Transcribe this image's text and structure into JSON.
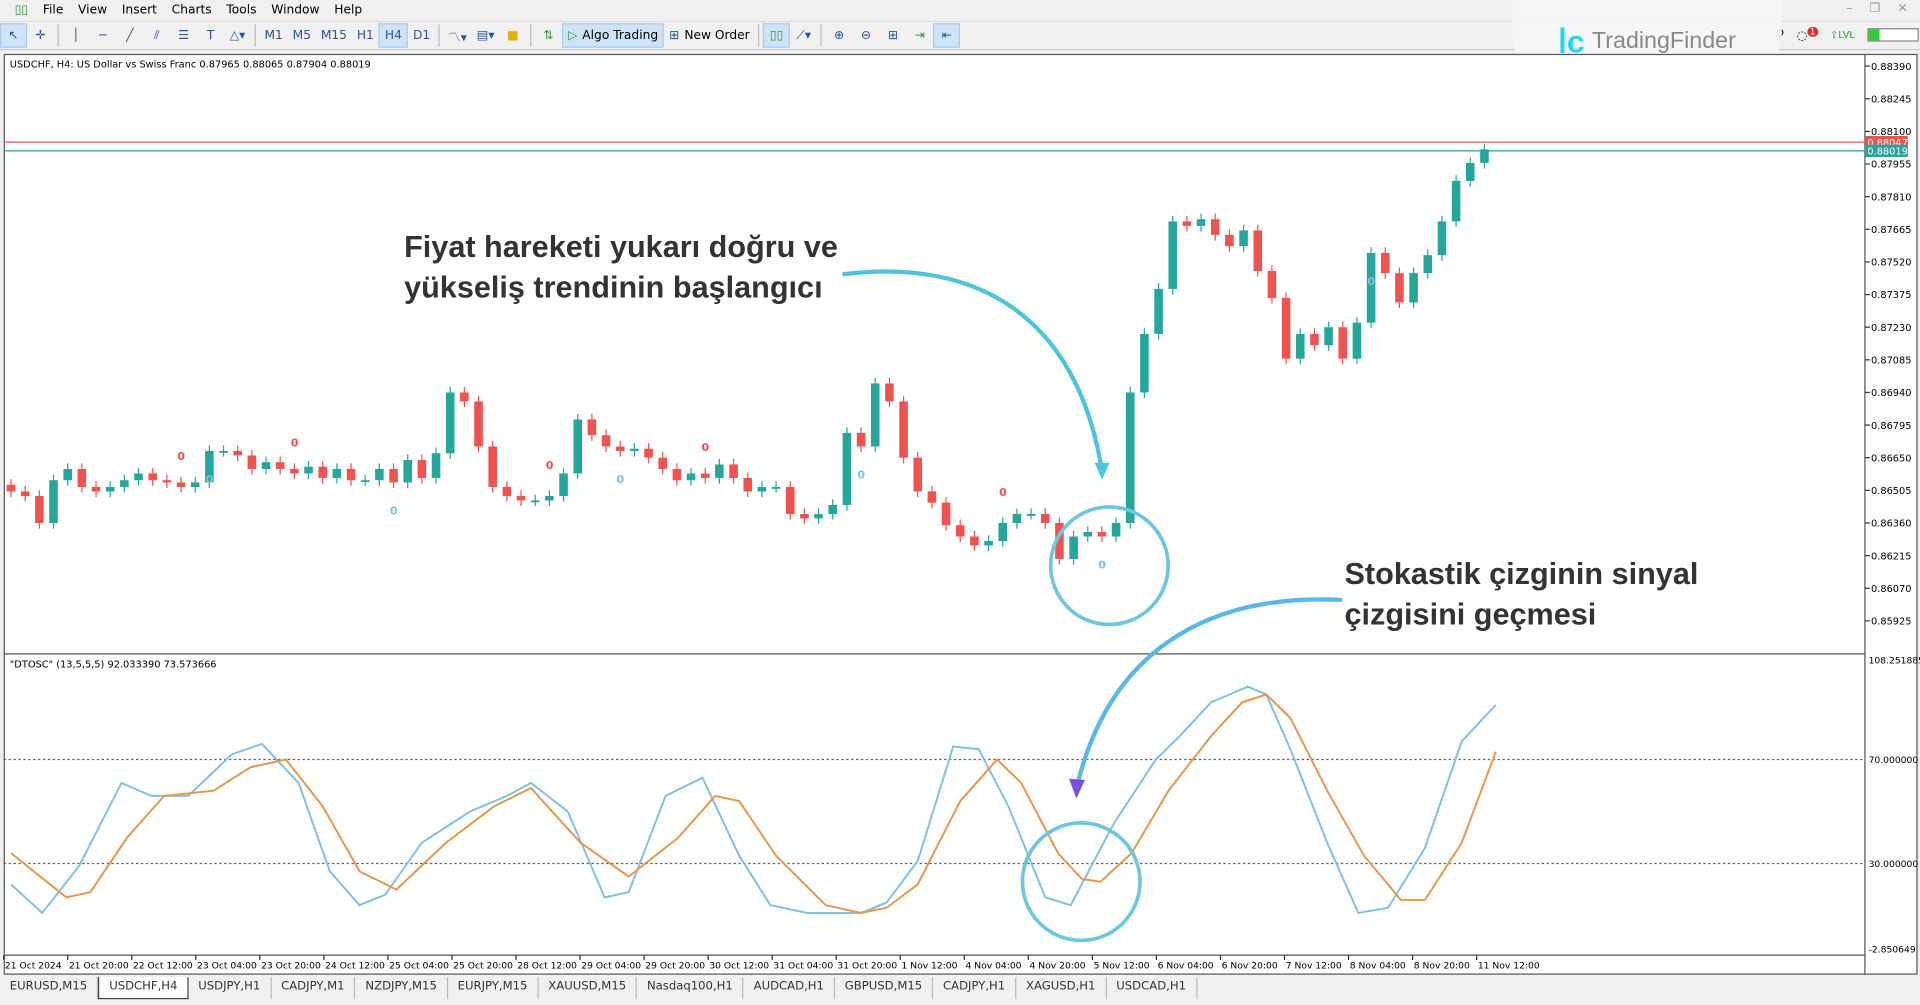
{
  "menu": [
    "File",
    "View",
    "Insert",
    "Charts",
    "Tools",
    "Window",
    "Help"
  ],
  "toolbar": {
    "timeframes": [
      "M1",
      "M5",
      "M15",
      "H1",
      "H4",
      "D1"
    ],
    "active_tf": "H4",
    "algo_trading": "Algo Trading",
    "new_order": "New Order"
  },
  "logo": "TradingFinder",
  "notification_count": "1",
  "chart": {
    "title": "USDCHF, H4:  US Dollar vs Swiss Franc  0.87965 0.88065 0.87904 0.88019",
    "indicator_title": "\"DTOSC\" (13,5,5,5) 92.033390 73.573666"
  },
  "annotations": {
    "top": [
      "Fiyat hareketi yukarı doğru ve",
      "yükseliş trendinin başlangıcı"
    ],
    "bottom": [
      "Stokastik çizginin sinyal",
      "çizgisini geçmesi"
    ]
  },
  "chart_data": [
    {
      "type": "candlestick",
      "symbol": "USDCHF",
      "timeframe": "H4",
      "bull_color": "#26a69a",
      "bear_color": "#ef5350",
      "price_labels": [
        "0.88390",
        "0.88245",
        "0.88100",
        "0.87955",
        "0.87810",
        "0.87665",
        "0.87520",
        "0.87375",
        "0.87230",
        "0.87085",
        "0.86940",
        "0.86795",
        "0.86650",
        "0.86505",
        "0.86360",
        "0.86215",
        "0.86070",
        "0.85925"
      ],
      "ask_label": "0.88047",
      "bid_label": "0.88019",
      "ask_price": 0.88047,
      "bid_price": 0.88019,
      "closes": [
        0.865,
        0.8648,
        0.8636,
        0.8655,
        0.866,
        0.8652,
        0.865,
        0.8652,
        0.8655,
        0.8658,
        0.8655,
        0.8654,
        0.8652,
        0.8654,
        0.8668,
        0.8668,
        0.8666,
        0.866,
        0.8663,
        0.866,
        0.8658,
        0.8661,
        0.8656,
        0.866,
        0.8655,
        0.8655,
        0.866,
        0.8654,
        0.8664,
        0.8656,
        0.8667,
        0.8694,
        0.869,
        0.867,
        0.8652,
        0.8648,
        0.8646,
        0.8646,
        0.8648,
        0.8658,
        0.8682,
        0.8675,
        0.867,
        0.8668,
        0.8669,
        0.8665,
        0.866,
        0.8655,
        0.8658,
        0.8656,
        0.8662,
        0.8656,
        0.865,
        0.8652,
        0.8652,
        0.864,
        0.8638,
        0.864,
        0.8644,
        0.8676,
        0.867,
        0.8698,
        0.869,
        0.8665,
        0.865,
        0.8645,
        0.8635,
        0.863,
        0.8626,
        0.8628,
        0.8636,
        0.864,
        0.864,
        0.8636,
        0.862,
        0.863,
        0.8632,
        0.863,
        0.8636,
        0.8694,
        0.872,
        0.874,
        0.877,
        0.8768,
        0.8771,
        0.8764,
        0.8759,
        0.8766,
        0.8748,
        0.8736,
        0.8709,
        0.872,
        0.8715,
        0.8723,
        0.8709,
        0.8725,
        0.8756,
        0.8747,
        0.8734,
        0.8747,
        0.8755,
        0.877,
        0.8788,
        0.8796,
        0.8802
      ],
      "signals_sell": [
        12,
        20,
        38,
        49,
        70,
        88
      ],
      "signals_buy": [
        14,
        27,
        43,
        60,
        77,
        96
      ],
      "time_labels": [
        "21 Oct 2024",
        "21 Oct 20:00",
        "22 Oct 12:00",
        "23 Oct 04:00",
        "23 Oct 20:00",
        "24 Oct 12:00",
        "25 Oct 04:00",
        "25 Oct 20:00",
        "28 Oct 12:00",
        "29 Oct 04:00",
        "29 Oct 20:00",
        "30 Oct 12:00",
        "31 Oct 04:00",
        "31 Oct 20:00",
        "1 Nov 12:00",
        "4 Nov 04:00",
        "4 Nov 20:00",
        "5 Nov 12:00",
        "6 Nov 04:00",
        "6 Nov 20:00",
        "7 Nov 12:00",
        "8 Nov 04:00",
        "8 Nov 20:00",
        "11 Nov 12:00"
      ]
    },
    {
      "type": "line",
      "name": "DTOSC",
      "ylim": [
        -2.850649,
        108.251885
      ],
      "axis_labels": [
        "108.251885",
        "70.000000",
        "30.000000",
        "-2.850649"
      ],
      "levels": [
        70,
        30
      ],
      "series": [
        {
          "color": "#7ec0e4",
          "points": [
            [
              0,
              22
            ],
            [
              2.2,
              11
            ],
            [
              4.8,
              29
            ],
            [
              7.8,
              61
            ],
            [
              9.9,
              56
            ],
            [
              12.5,
              56
            ],
            [
              15.6,
              72
            ],
            [
              17.7,
              76
            ],
            [
              20.3,
              61
            ],
            [
              22.5,
              27
            ],
            [
              24.6,
              14
            ],
            [
              26.4,
              18
            ],
            [
              29,
              38
            ],
            [
              32.4,
              50
            ],
            [
              35,
              56
            ],
            [
              36.7,
              61
            ],
            [
              39.3,
              50
            ],
            [
              41.9,
              17
            ],
            [
              43.6,
              19
            ],
            [
              46.2,
              56
            ],
            [
              48.8,
              63
            ],
            [
              51.4,
              33
            ],
            [
              53.6,
              14
            ],
            [
              56.2,
              11
            ],
            [
              60,
              11
            ],
            [
              61.8,
              15
            ],
            [
              64,
              31
            ],
            [
              66.5,
              75
            ],
            [
              68.3,
              74
            ],
            [
              70.4,
              52
            ],
            [
              73,
              17
            ],
            [
              74.8,
              14
            ],
            [
              77.8,
              45
            ],
            [
              80.8,
              70
            ],
            [
              82.5,
              79
            ],
            [
              84.7,
              92
            ],
            [
              87.3,
              98
            ],
            [
              88.6,
              95
            ],
            [
              90.3,
              74
            ],
            [
              92.9,
              38
            ],
            [
              95.1,
              11
            ],
            [
              97.2,
              13
            ],
            [
              99.8,
              36
            ],
            [
              102.4,
              77
            ],
            [
              104.8,
              91
            ]
          ]
        },
        {
          "color": "#e8964a",
          "points": [
            [
              0,
              34
            ],
            [
              3.9,
              17
            ],
            [
              5.6,
              19
            ],
            [
              8.2,
              40
            ],
            [
              10.8,
              56
            ],
            [
              14.3,
              58
            ],
            [
              16.9,
              67
            ],
            [
              19.4,
              70
            ],
            [
              22,
              52
            ],
            [
              24.6,
              27
            ],
            [
              27.2,
              20
            ],
            [
              30.7,
              38
            ],
            [
              34.1,
              52
            ],
            [
              36.7,
              59
            ],
            [
              40.2,
              38
            ],
            [
              43.6,
              25
            ],
            [
              47.1,
              40
            ],
            [
              49.7,
              56
            ],
            [
              51.4,
              54
            ],
            [
              54,
              33
            ],
            [
              57.5,
              14
            ],
            [
              60,
              11
            ],
            [
              61.8,
              13
            ],
            [
              64,
              22
            ],
            [
              67,
              54
            ],
            [
              69.6,
              70
            ],
            [
              71.3,
              61
            ],
            [
              73.9,
              34
            ],
            [
              75.6,
              24
            ],
            [
              76.9,
              23
            ],
            [
              79.1,
              34
            ],
            [
              81.7,
              58
            ],
            [
              84.7,
              79
            ],
            [
              86.9,
              92
            ],
            [
              88.6,
              95
            ],
            [
              90.3,
              86
            ],
            [
              92.9,
              58
            ],
            [
              95.5,
              33
            ],
            [
              98.1,
              16
            ],
            [
              99.8,
              16
            ],
            [
              102.4,
              38
            ],
            [
              104.8,
              73
            ]
          ]
        }
      ]
    }
  ],
  "tabs": [
    "EURUSD,M15",
    "USDCHF,H4",
    "USDJPY,H1",
    "CADJPY,M1",
    "NZDJPY,M15",
    "EURJPY,M15",
    "XAUUSD,M15",
    "Nasdaq100,H1",
    "AUDCAD,H1",
    "GBPUSD,M15",
    "CADJPY,H1",
    "XAGUSD,H1",
    "USDCAD,H1"
  ],
  "active_tab": "USDCHF,H4"
}
